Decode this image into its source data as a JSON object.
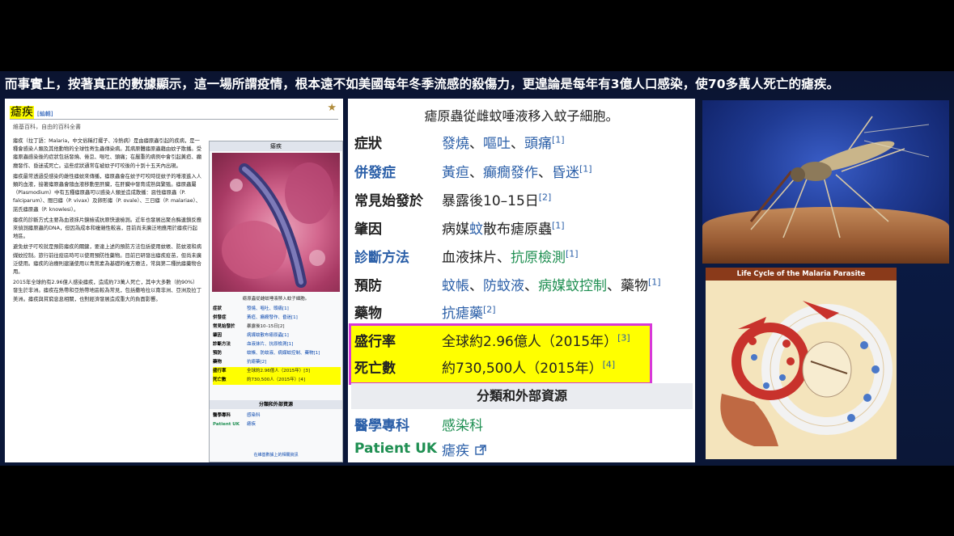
{
  "headline": "而事實上，按著真正的數據顯示，這一場所謂疫情，根本遠不如美國每年冬季流感的殺傷力，更遑論是每年有3億人口感染，使70多萬人死亡的瘧疾。",
  "wiki": {
    "title": "瘧疾",
    "edit": "[編輯]",
    "subtitle": "維基百科，自由的百科全書",
    "para1": "瘧疾（拉丁語：Malaria，中文俗稱打擺子、冷熱病）是由瘧原蟲引起的疾病，是一種會感染人類及其他動物的全球性寄生蟲傳染病。其病原體瘧原蟲藉由蚊子散播。受瘧原蟲感染後的症狀包括發燒、倦怠、嘔吐、頭痛；在嚴重的病例中會引起黃疸、癲癇發作、昏迷或死亡。這些症狀通常在被蚊子叮咬後的十到十五天內出現。",
    "para2": "瘧疾最常透過受感染的雌性瘧蚊來傳播，瘧原蟲會在蚊子叮咬時從蚊子的唾液進入人類的血液，接著瘧原蟲會隨血液移動至肝臟，在肝臟中發育成熟與繁殖。瘧原蟲屬（Plasmodium）中有五種瘧原蟲可以感染人類並造成散播：惡性瘧原蟲（P. falciparum）、間日瘧（P. vivax）及卵形瘧（P. ovale）、三日瘧（P. malariae）、諾氏瘧原蟲（P. knowlesi）。",
    "para3": "瘧疾的診斷方式主要為血液抹片鏡檢或抗原快速檢測。近年也發展出聚合酶連鎖反應來偵測瘧原蟲的DNA，但因為成本和複雜性較高，目前尚未廣泛地應用於瘧疾行起地區。",
    "para4": "避免蚊子叮咬就是預防瘧疾的關鍵，要達上述的預防方法包括使用蚊帳、防蚊液和病媒蚊控制。旅行前往疫區時可以使用預防性藥物。目前已研發出瘧疾疫苗，但尚未廣泛使用。瘧疾的治療則建議使用以青蒿素為基礎的複方療法，常與第二種抗瘧藥物合用。",
    "para5": "2015年全球約有2.96億人感染瘧疾，造成約73萬人死亡，其中大多數（約90%）發生於非洲。瘧疾在熱帶和亞熱帶地區較為常見，包括撒哈拉以南非洲、亞洲及拉丁美洲。瘧疾與貧窮息息相關，也對經濟發展造成重大的負面影響。",
    "star": "★"
  },
  "infobox": {
    "title": "瘧疾",
    "caption": "瘧原蟲從雌蚊唾液移入蚊子細胞。",
    "rows": [
      {
        "k": "症狀",
        "v": "發燒、嘔吐、頭痛[1]"
      },
      {
        "k": "併發症",
        "v": "黃疸、癲癇發作、昏迷[1]"
      },
      {
        "k": "常見始發於",
        "v": "暴露後10–15日[2]"
      },
      {
        "k": "肇因",
        "v": "病媒蚊散布瘧原蟲[1]"
      },
      {
        "k": "診斷方法",
        "v": "血液抹片、抗原檢測[1]"
      },
      {
        "k": "預防",
        "v": "蚊帳、防蚊液、病媒蚊控制、藥物[1]"
      },
      {
        "k": "藥物",
        "v": "抗瘧藥[2]"
      }
    ],
    "hl_rows": [
      {
        "k": "盛行率",
        "v": "全球約2.96億人（2015年）[3]"
      },
      {
        "k": "死亡數",
        "v": "約730,500人（2015年）[4]"
      }
    ],
    "section": "分類和外部資源",
    "ext_rows": [
      {
        "k": "醫學專科",
        "v": "感染科"
      },
      {
        "k": "Patient UK",
        "v": "瘧疾"
      }
    ],
    "footer": "在維基數據上的相關資訊"
  },
  "main": {
    "caption": "瘧原蟲從雌蚊唾液移入蚊子細胞。",
    "symptoms_label": "症狀",
    "symptoms": [
      "發燒",
      "嘔吐",
      "頭痛"
    ],
    "symptoms_ref": "[1]",
    "complications_label": "併發症",
    "complications": [
      "黃疸",
      "癲癇發作",
      "昏迷"
    ],
    "complications_ref": "[1]",
    "onset_label": "常見始發於",
    "onset": "暴露後10–15日",
    "onset_ref": "[2]",
    "cause_label": "肇因",
    "cause_a": "病媒",
    "cause_b": "蚊",
    "cause_c": "散布瘧原蟲",
    "cause_ref": "[1]",
    "diagnosis_label": "診斷方法",
    "diagnosis_a": "血液抹片、",
    "diagnosis_b": "抗原檢測",
    "diagnosis_ref": "[1]",
    "prevention_label": "預防",
    "prevention_a": "蚊帳",
    "prevention_b": "防蚊液",
    "prevention_c": "病媒蚊控制",
    "prevention_d": "、藥物",
    "prevention_ref": "[1]",
    "medication_label": "藥物",
    "medication": "抗瘧藥",
    "medication_ref": "[2]",
    "prevalence_label": "盛行率",
    "prevalence": "全球約2.96億人（2015年）",
    "prevalence_ref": "[3]",
    "deaths_label": "死亡數",
    "deaths": "約730,500人（2015年）",
    "deaths_ref": "[4]",
    "section": "分類和外部資源",
    "specialty_label": "醫學專科",
    "specialty": "感染科",
    "patientuk_label": "Patient UK",
    "patientuk": "瘧疾",
    "external_icon": "external-link-icon"
  },
  "lifecycle": {
    "title": "Life Cycle of the Malaria Parasite"
  },
  "colors": {
    "highlight": "#ffff00",
    "highlight_border": "#d838d8",
    "link_blue": "#2b5fa8",
    "link_green": "#1f8f52"
  }
}
